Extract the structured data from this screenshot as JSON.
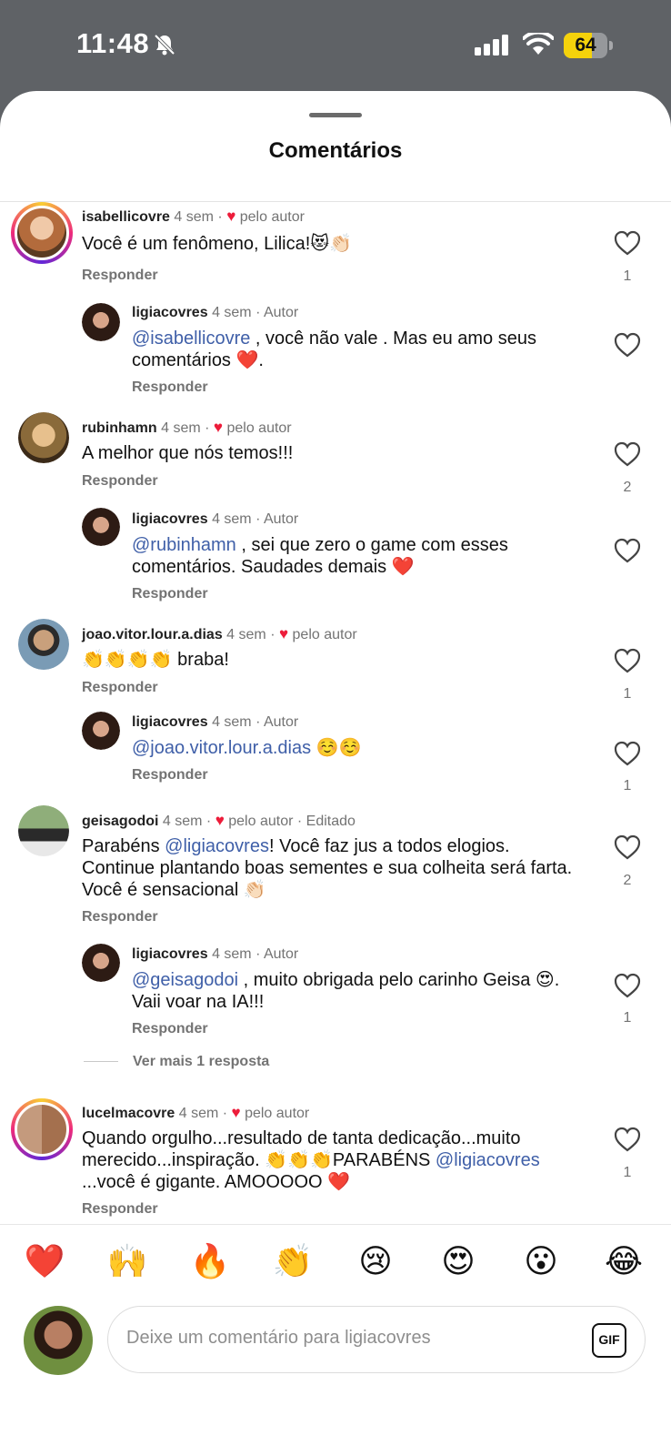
{
  "status_bar": {
    "time": "11:48",
    "battery": "64",
    "battery_level": 0.64
  },
  "sheet": {
    "title": "Comentários"
  },
  "comments": [
    {
      "username": "isabellicovre",
      "time": "4 sem",
      "liked_by_author": "pelo autor",
      "text": "Você é um fenômeno, Lilica!😻👏🏻",
      "reply_label": "Responder",
      "likes": "1"
    },
    {
      "username": "ligiacovres",
      "time": "4 sem",
      "tag": "Autor",
      "mention": "@isabellicovre",
      "text": " , você não vale . Mas eu amo seus comentários ❤️.",
      "reply_label": "Responder",
      "likes": ""
    },
    {
      "username": "rubinhamn",
      "time": "4 sem",
      "liked_by_author": "pelo autor",
      "text": "A melhor que nós temos!!!",
      "reply_label": "Responder",
      "likes": "2"
    },
    {
      "username": "ligiacovres",
      "time": "4 sem",
      "tag": "Autor",
      "mention": "@rubinhamn",
      "text": " , sei que zero o game com esses comentários. Saudades demais ❤️",
      "reply_label": "Responder",
      "likes": ""
    },
    {
      "username": "joao.vitor.lour.a.dias",
      "time": "4 sem",
      "liked_by_author": "pelo autor",
      "text": "👏👏👏👏 braba!",
      "reply_label": "Responder",
      "likes": "1"
    },
    {
      "username": "ligiacovres",
      "time": "4 sem",
      "tag": "Autor",
      "mention": "@joao.vitor.lour.a.dias",
      "text": " ☺️☺️",
      "reply_label": "Responder",
      "likes": "1"
    },
    {
      "username": "geisagodoi",
      "time": "4 sem",
      "liked_by_author": "pelo autor",
      "edited": "Editado",
      "text_before": "Parabéns ",
      "mention": "@ligiacovres",
      "text": "! Você faz jus a todos elogios. Continue plantando boas sementes e sua colheita será farta. Você é sensacional 👏🏻",
      "reply_label": "Responder",
      "likes": "2"
    },
    {
      "username": "ligiacovres",
      "time": "4 sem",
      "tag": "Autor",
      "mention": "@geisagodoi",
      "text": " , muito obrigada pelo carinho Geisa 😍. Vaii voar na IA!!!",
      "reply_label": "Responder",
      "likes": "1"
    },
    {
      "username": "lucelmacovre",
      "time": "4 sem",
      "liked_by_author": "pelo autor",
      "text_before": "Quando orgulho...resultado de tanta dedicação...muito merecido...inspiração. 👏👏👏PARABÉNS ",
      "mention": "@ligiacovres",
      "text": " ...você é gigante. AMOOOOO ❤️",
      "reply_label": "Responder",
      "likes": "1"
    }
  ],
  "more_replies": "Ver mais 1 resposta",
  "emoji_bar": [
    "❤️",
    "🙌",
    "🔥",
    "👏",
    "😢",
    "😍",
    "😮",
    "😂"
  ],
  "composer": {
    "placeholder": "Deixe um comentário para ligiacovres",
    "gif_label": "GIF"
  },
  "colors": {
    "mention": "#3f5fa8",
    "heart": "#ed1c3a",
    "secondary_text": "#737373"
  }
}
